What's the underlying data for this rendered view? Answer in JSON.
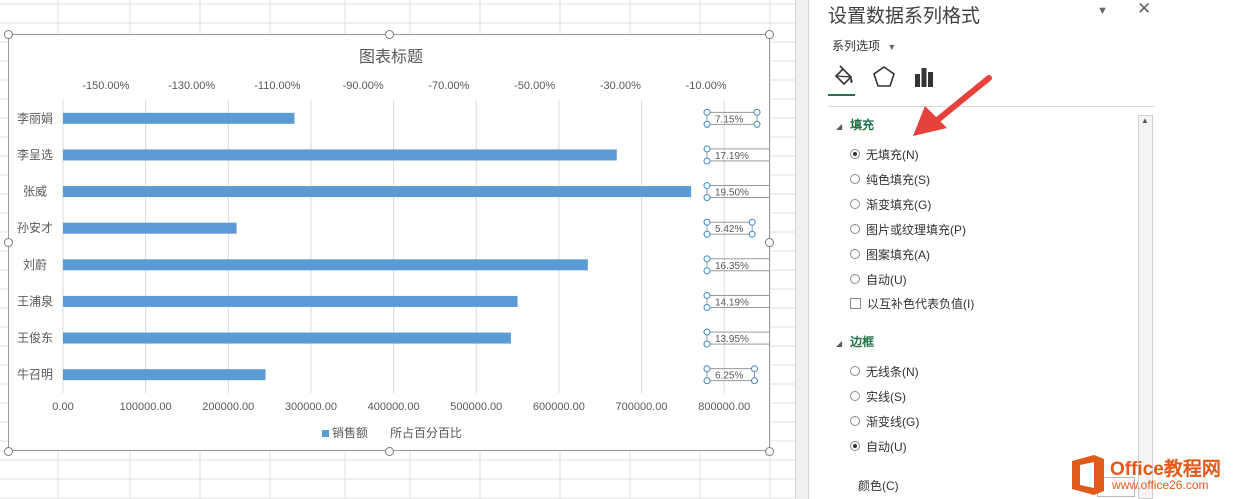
{
  "pane": {
    "title": "设置数据系列格式",
    "series_options": "系列选项",
    "tabs": [
      {
        "icon": "paint-bucket-icon",
        "selected": true
      },
      {
        "icon": "pentagon-icon",
        "selected": false
      },
      {
        "icon": "bar-chart-icon",
        "selected": false
      }
    ],
    "fill": {
      "heading": "填充",
      "options": [
        "无填充(N)",
        "纯色填充(S)",
        "渐变填充(G)",
        "图片或纹理填充(P)",
        "图案填充(A)",
        "自动(U)"
      ],
      "selected": 0,
      "invert_label": "以互补色代表负值(I)"
    },
    "border": {
      "heading": "边框",
      "options": [
        "无线条(N)",
        "实线(S)",
        "渐变线(G)",
        "自动(U)"
      ],
      "selected": 3
    },
    "color_label": "颜色(C)"
  },
  "watermark": {
    "line1": "Office教程网",
    "line2": "www.office26.com"
  },
  "colors": {
    "bar": "#5b9bd5",
    "accent": "#217346",
    "arrow": "#e8413c",
    "watermark": "#e05a1a"
  },
  "chart_data": {
    "type": "bar",
    "title": "图表标题",
    "orientation": "horizontal",
    "categories": [
      "李丽娟",
      "李呈选",
      "张威",
      "孙安才",
      "刘蔚",
      "王浦泉",
      "王俊东",
      "牛召明"
    ],
    "series": [
      {
        "name": "销售额",
        "values": [
          280000,
          670000,
          760000,
          210000,
          635000,
          550000,
          542000,
          245000
        ]
      },
      {
        "name": "所占百分百比",
        "values": [
          0.0715,
          0.1719,
          0.195,
          0.0542,
          0.1635,
          0.1419,
          0.1395,
          0.0625
        ]
      }
    ],
    "data_labels": [
      "7.15%",
      "17.19%",
      "19.50%",
      "5.42%",
      "16.35%",
      "14.19%",
      "13.95%",
      "6.25%"
    ],
    "x_ticks": [
      "0.00",
      "100000.00",
      "200000.00",
      "300000.00",
      "400000.00",
      "500000.00",
      "600000.00",
      "700000.00",
      "800000.00"
    ],
    "xlim": [
      0,
      830000
    ],
    "secondary_ticks": [
      "-150.00%",
      "-130.00%",
      "-110.00%",
      "-90.00%",
      "-70.00%",
      "-50.00%",
      "-30.00%",
      "-10.00%"
    ],
    "legend_position": "bottom",
    "grid": true
  }
}
